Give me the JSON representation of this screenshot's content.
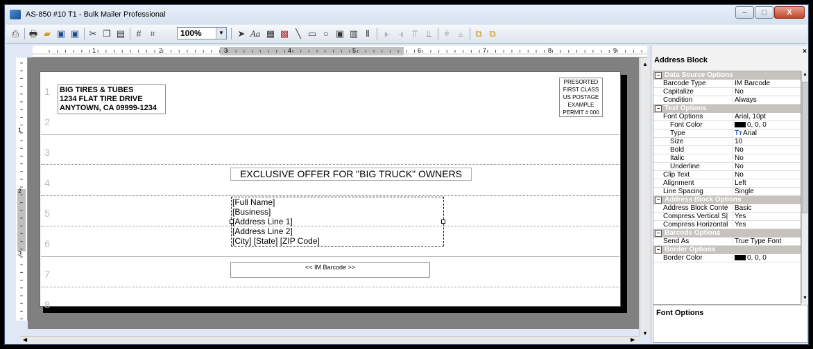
{
  "window": {
    "title": "AS-850 #10 T1 - Bulk Mailer Professional"
  },
  "window_buttons": {
    "minimize": "–",
    "maximize": "□",
    "close": "X"
  },
  "toolbar": {
    "zoom": "100%"
  },
  "ruler": {
    "h_labels": [
      "1",
      "2",
      "3",
      "4",
      "5",
      "6",
      "7",
      "8",
      "9"
    ],
    "v_labels": [
      "1",
      "2",
      "3"
    ]
  },
  "document": {
    "line_numbers": [
      "1",
      "2",
      "3",
      "4",
      "5",
      "6",
      "7",
      "8"
    ],
    "return_address": [
      "BIG TIRES & TUBES",
      "1234 FLAT TIRE DRIVE",
      "ANYTOWN, CA 09999-1234"
    ],
    "permit": [
      "PRESORTED",
      "FIRST CLASS",
      "US POSTAGE",
      "EXAMPLE",
      "PERMIT # 000"
    ],
    "offer": "EXCLUSIVE OFFER FOR \"BIG TRUCK\" OWNERS",
    "address_block": [
      "[Full Name]",
      "[Business]",
      "[Address Line 1]",
      "[Address Line 2]",
      "[City] [State] [ZIP Code]"
    ],
    "barcode": "<< IM Barcode >>"
  },
  "panel": {
    "title": "Address Block",
    "close": "×",
    "description_title": "Font Options",
    "categories": [
      {
        "name": "Data Source Options",
        "props": [
          {
            "name": "Barcode Type",
            "value": "IM Barcode"
          },
          {
            "name": "Capitalize",
            "value": "No"
          },
          {
            "name": "Condition",
            "value": "Always"
          }
        ]
      },
      {
        "name": "Text Options",
        "props": [
          {
            "name": "Font Options",
            "value": "Arial, 10pt"
          },
          {
            "name": "Font Color",
            "value": "0, 0, 0",
            "swatch": "#000000",
            "sub": true
          },
          {
            "name": "Type",
            "value": "Arial",
            "icon": "tt-icon",
            "sub": true
          },
          {
            "name": "Size",
            "value": "10",
            "sub": true
          },
          {
            "name": "Bold",
            "value": "No",
            "sub": true
          },
          {
            "name": "Italic",
            "value": "No",
            "sub": true
          },
          {
            "name": "Underline",
            "value": "No",
            "sub": true
          },
          {
            "name": "Clip Text",
            "value": "No"
          },
          {
            "name": "Alignment",
            "value": "Left"
          },
          {
            "name": "Line Spacing",
            "value": "Single"
          }
        ]
      },
      {
        "name": "Address Block Options",
        "props": [
          {
            "name": "Address Block Conte",
            "value": "Basic"
          },
          {
            "name": "Compress Vertical S|",
            "value": "Yes"
          },
          {
            "name": "Compress Horizontal",
            "value": "Yes"
          }
        ]
      },
      {
        "name": "Barcode Options",
        "props": [
          {
            "name": "Send As",
            "value": "True Type Font"
          }
        ]
      },
      {
        "name": "Border Options",
        "props": [
          {
            "name": "Border Color",
            "value": "0, 0, 0",
            "swatch": "#000000"
          }
        ]
      }
    ]
  }
}
